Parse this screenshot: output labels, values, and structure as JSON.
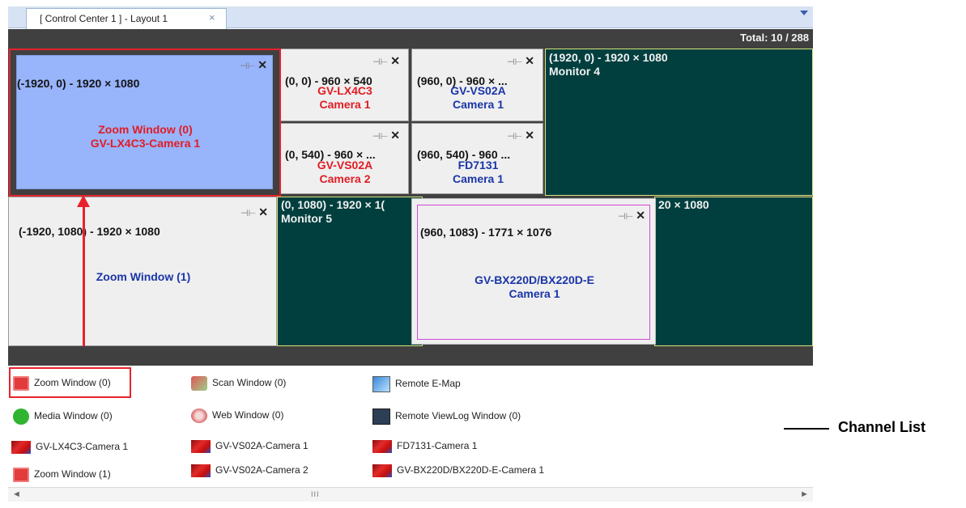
{
  "tab": {
    "title": "[ Control Center 1 ] - Layout 1",
    "close": "×"
  },
  "total": "Total: 10 / 288",
  "cells": {
    "zoom0": {
      "coords": "(-1920, 0) - 1920 × 1080",
      "line1": "Zoom Window (0)",
      "line2": "GV-LX4C3-Camera 1"
    },
    "c1": {
      "coords": "(0, 0) - 960 × 540",
      "name": "GV-LX4C3",
      "cam": "Camera 1"
    },
    "c2": {
      "coords": "(960, 0) - 960 × ...",
      "name": "GV-VS02A",
      "cam": "Camera 1"
    },
    "c3": {
      "coords": "(0, 540) - 960 × ...",
      "name": "GV-VS02A",
      "cam": "Camera 2"
    },
    "c4": {
      "coords": "(960, 540) - 960 ...",
      "name": "FD7131",
      "cam": "Camera 1"
    },
    "zoom1": {
      "coords": "(-1920, 1080) - 1920 × 1080",
      "line1": "Zoom Window (1)"
    },
    "float": {
      "coords": "(960, 1083) - 1771 × 1076",
      "line1": "GV-BX220D/BX220D-E",
      "line2": "Camera 1"
    }
  },
  "monitors": {
    "m4": {
      "coords": "(1920, 0) - 1920 × 1080",
      "label": "Monitor 4"
    },
    "m5": {
      "coords": "(0, 1080) - 1920 × 1(",
      "label": "Monitor 5"
    },
    "m6": {
      "coords": "20 × 1080"
    }
  },
  "list": {
    "zoom0": "Zoom Window (0)",
    "scan": "Scan Window (0)",
    "emap": "Remote E-Map",
    "media": "Media Window (0)",
    "web": "Web Window (0)",
    "viewlog": "Remote ViewLog Window (0)",
    "cam1": "GV-LX4C3-Camera 1",
    "cam2": "GV-VS02A-Camera 1",
    "cam3": "FD7131-Camera 1",
    "zoom1": "Zoom Window (1)",
    "cam4": "GV-VS02A-Camera 2",
    "cam5": "GV-BX220D/BX220D-E-Camera 1"
  },
  "scrollbar": {
    "left": "◄",
    "right": "►",
    "grip": "III"
  },
  "callout": "Channel List",
  "icons": {
    "pin": "⊣⊢",
    "close": "✕"
  },
  "colors": {
    "monitor_bg": "#013f3f",
    "label_red": "#e21c24",
    "label_blue": "#1a35a8",
    "zoom_bg": "#98b4fb",
    "highlight": "#e8222a"
  }
}
